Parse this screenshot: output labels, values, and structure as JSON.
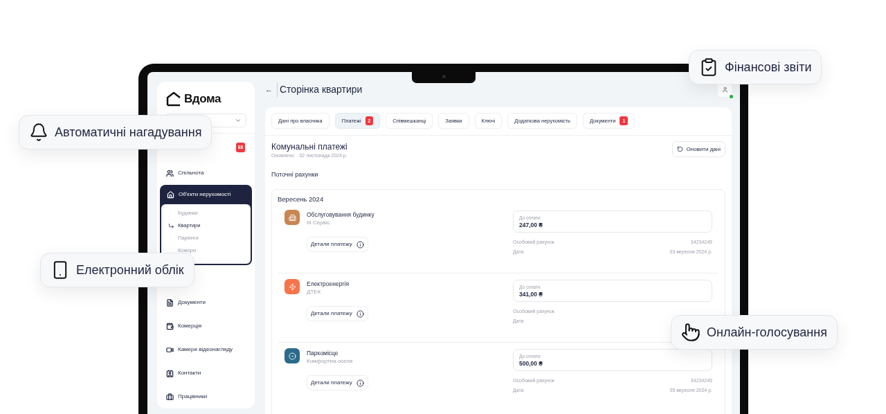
{
  "sidebar": {
    "logo": "Вдома",
    "badge": "88",
    "items": [
      {
        "label": "Спільнота",
        "expanded": false
      },
      {
        "label": "Об'єкти нерухомості",
        "expanded": true,
        "children": [
          {
            "label": "Будинки",
            "selected": false
          },
          {
            "label": "Квартири",
            "selected": true
          },
          {
            "label": "Паркінги",
            "selected": false
          },
          {
            "label": "Комори",
            "selected": false
          }
        ]
      },
      {
        "label": "Документи",
        "expanded": false
      },
      {
        "label": "Комерція",
        "expanded": false
      },
      {
        "label": "Камери відеонагляду",
        "expanded": false
      },
      {
        "label": "Контакти",
        "expanded": false
      },
      {
        "label": "Працівники",
        "expanded": false
      }
    ]
  },
  "header": {
    "back": "←",
    "title": "Сторінка квартири",
    "online": true
  },
  "tabs": [
    {
      "label": "Дані про власника",
      "selected": false
    },
    {
      "label": "Платежі",
      "selected": true,
      "count": "2"
    },
    {
      "label": "Співмешканці",
      "selected": false
    },
    {
      "label": "Заявки",
      "selected": false
    },
    {
      "label": "Ключі",
      "selected": false
    },
    {
      "label": "Додаткова нерухомість",
      "selected": false
    },
    {
      "label": "Документи",
      "selected": false,
      "count": "1"
    }
  ],
  "section": {
    "title": "Комунальні платежі",
    "updated_label": "Оновлено:",
    "updated": "02 листопада 2024 р.",
    "refresh": "Оновити дані",
    "subtitle": "Поточні рахунки"
  },
  "month": "Вересень 2024",
  "payments": [
    {
      "kind": "service",
      "color": "#c98552",
      "title": "Обслуговування будинку",
      "provider": "ІІІ Сервіс",
      "amount_label": "До сплати",
      "amount": "247,00 ₴",
      "account_label": "Особовий рахунок",
      "account": "34234245",
      "date_label": "Дата",
      "date": "03 вересня 2024 р.",
      "details": "Детали платежу"
    },
    {
      "kind": "power",
      "color": "#f7744a",
      "title": "Електроенергія",
      "provider": "ДТЕК",
      "amount_label": "До сплати",
      "amount": "341,00 ₴",
      "account_label": "Особовий рахунок",
      "date_label": "Дата",
      "details": "Детали платежу"
    },
    {
      "kind": "parking",
      "color": "#2b6a8a",
      "title": "Паркомісце",
      "provider": "Комфортна оселя",
      "amount_label": "До сплати",
      "amount": "500,00 ₴",
      "account_label": "Особовий рахунок",
      "account": "34234245",
      "date_label": "Дата",
      "date": "05 вересня 2024 р.",
      "details": "Детали платежу"
    }
  ],
  "chips": [
    {
      "kind": "reports",
      "label": "Фінансові звіти"
    },
    {
      "kind": "reminders",
      "label": "Автоматичні нагадування"
    },
    {
      "kind": "accounting",
      "label": "Електронний облік"
    },
    {
      "kind": "voting",
      "label": "Онлайн-голосування"
    }
  ]
}
